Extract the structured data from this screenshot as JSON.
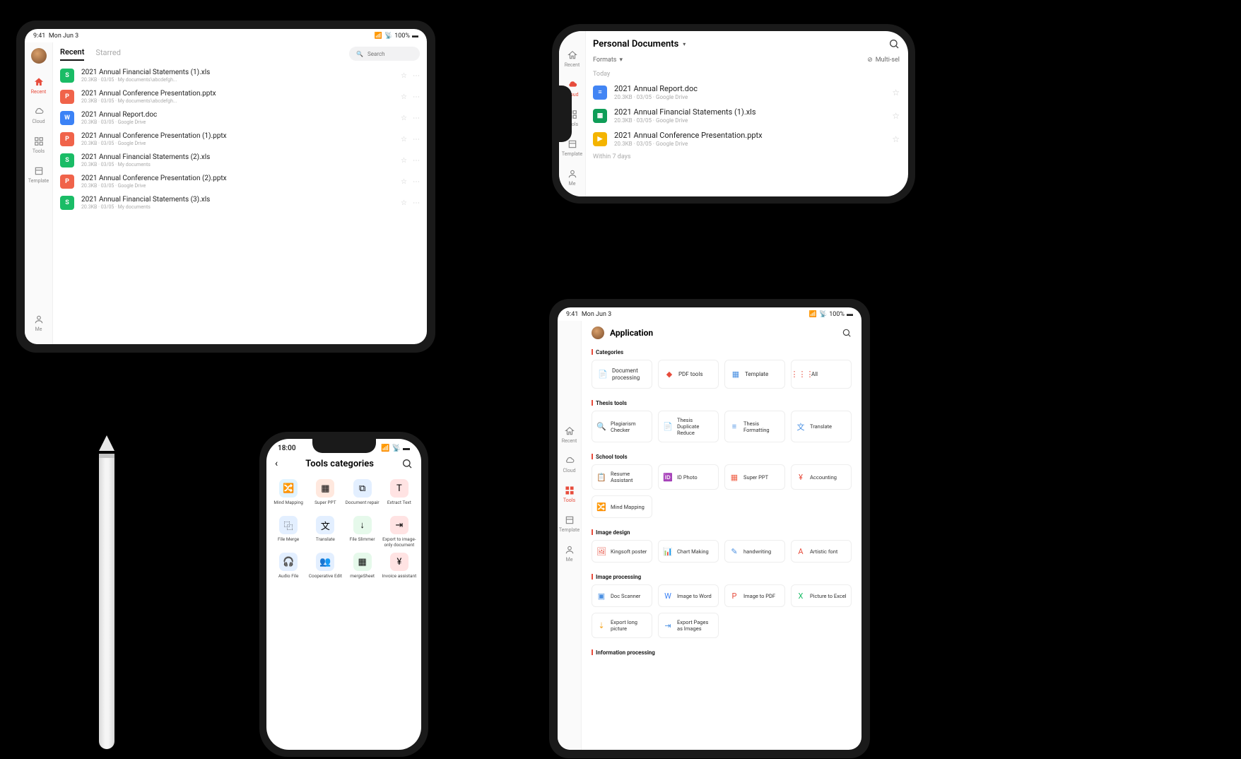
{
  "status": {
    "time": "9:41",
    "day": "Mon Jun 3",
    "battery": "100%"
  },
  "dev3_status_time": "18:00",
  "ipad1": {
    "nav": {
      "recent": "Recent",
      "cloud": "Cloud",
      "tools": "Tools",
      "template": "Template",
      "me": "Me"
    },
    "tabs": {
      "recent": "Recent",
      "starred": "Starred"
    },
    "search_placeholder": "Search",
    "files": [
      {
        "name": "2021 Annual Financial Statements (1).xls",
        "meta": "20.3KB · 03/05 · My documents\\abcdefgh...",
        "type": "xls"
      },
      {
        "name": "2021 Annual Conference Presentation.pptx",
        "meta": "20.3KB · 03/05 · My documents\\abcdefgh...",
        "type": "ppt"
      },
      {
        "name": "2021 Annual Report.doc",
        "meta": "20.3KB · 03/05 · Google Drive",
        "type": "doc"
      },
      {
        "name": "2021 Annual Conference Presentation (1).pptx",
        "meta": "20.3KB · 03/05 · Google Drive",
        "type": "ppt"
      },
      {
        "name": "2021 Annual Financial Statements (2).xls",
        "meta": "20.3KB · 03/05 · My documents",
        "type": "xls"
      },
      {
        "name": "2021 Annual Conference Presentation (2).pptx",
        "meta": "20.3KB · 03/05 · Google Drive",
        "type": "ppt"
      },
      {
        "name": "2021 Annual Financial Statements (3).xls",
        "meta": "20.3KB · 03/05 · My documents",
        "type": "xls"
      }
    ]
  },
  "phone_cloud": {
    "nav": {
      "recent": "Recent",
      "cloud": "Cloud",
      "tools": "Tools",
      "template": "Template",
      "me": "Me"
    },
    "title": "Personal Documents",
    "formats": "Formats",
    "multi": "Multi-sel",
    "today": "Today",
    "within7": "Within 7 days",
    "files": [
      {
        "name": "2021 Annual Report.doc",
        "meta": "20.3KB · 03/05 · Google Drive",
        "type": "gdoc"
      },
      {
        "name": "2021 Annual Financial Statements (1).xls",
        "meta": "20.3KB · 03/05 · Google Drive",
        "type": "gsheet"
      },
      {
        "name": "2021 Annual Conference Presentation.pptx",
        "meta": "20.3KB · 03/05 · Google Drive",
        "type": "gslide"
      }
    ]
  },
  "phone_tools": {
    "title": "Tools categories",
    "tools": [
      {
        "label": "Mind Mapping",
        "color": "#e0f3ff",
        "glyph": "🔀"
      },
      {
        "label": "Super PPT",
        "color": "#ffe8de",
        "glyph": "▦"
      },
      {
        "label": "Document repair",
        "color": "#e3efff",
        "glyph": "⧉"
      },
      {
        "label": "Extract Text",
        "color": "#ffe3e3",
        "glyph": "T"
      },
      {
        "label": "File Merge",
        "color": "#e3efff",
        "glyph": "⿻"
      },
      {
        "label": "Translate",
        "color": "#e3efff",
        "glyph": "文"
      },
      {
        "label": "File Slimmer",
        "color": "#e6f9eb",
        "glyph": "↓"
      },
      {
        "label": "Export to image-only document",
        "color": "#ffe3e3",
        "glyph": "⇥"
      },
      {
        "label": "Audio File",
        "color": "#e3efff",
        "glyph": "🎧"
      },
      {
        "label": "Cooperative Edit",
        "color": "#e3efff",
        "glyph": "👥"
      },
      {
        "label": "mergeSheet",
        "color": "#e6f9eb",
        "glyph": "▦"
      },
      {
        "label": "Invoice assistant",
        "color": "#ffe3e3",
        "glyph": "¥"
      }
    ]
  },
  "ipad_app": {
    "nav": {
      "recent": "Recent",
      "cloud": "Cloud",
      "tools": "Tools",
      "template": "Template",
      "me": "Me"
    },
    "title": "Application",
    "sections": {
      "categories": "Categories",
      "thesis": "Thesis tools",
      "school": "School tools",
      "image_design": "Image design",
      "image_proc": "Image processing",
      "info_proc": "Information processing"
    },
    "categories": [
      {
        "label": "Document processing",
        "glyph": "📄",
        "color": "#4a90e2"
      },
      {
        "label": "PDF tools",
        "glyph": "◆",
        "color": "#e74c3c"
      },
      {
        "label": "Template",
        "glyph": "▦",
        "color": "#4a90e2"
      },
      {
        "label": "All",
        "glyph": "⋮⋮⋮",
        "color": "#e74c3c"
      }
    ],
    "thesis": [
      {
        "label": "Plagiarism Checker",
        "glyph": "🔍",
        "color": "#4a90e2"
      },
      {
        "label": "Thesis Duplicate Reduce",
        "glyph": "📄",
        "color": "#e74c3c"
      },
      {
        "label": "Thesis Formatting",
        "glyph": "≡",
        "color": "#4a90e2"
      },
      {
        "label": "Translate",
        "glyph": "文",
        "color": "#4a90e2"
      }
    ],
    "school": [
      {
        "label": "Resume Assistant",
        "glyph": "📋",
        "color": "#f5a623"
      },
      {
        "label": "ID Photo",
        "glyph": "🆔",
        "color": "#e74c3c"
      },
      {
        "label": "Super PPT",
        "glyph": "▦",
        "color": "#f0634a"
      },
      {
        "label": "Accounting",
        "glyph": "¥",
        "color": "#e74c3c"
      },
      {
        "label": "Mind Mapping",
        "glyph": "🔀",
        "color": "#4a90e2"
      }
    ],
    "image_design": [
      {
        "label": "Kingsoft poster",
        "glyph": "🖼",
        "color": "#e74c3c"
      },
      {
        "label": "Chart Making",
        "glyph": "📊",
        "color": "#1abc66"
      },
      {
        "label": "handwriting",
        "glyph": "✎",
        "color": "#4a90e2"
      },
      {
        "label": "Artistic font",
        "glyph": "A",
        "color": "#e74c3c"
      }
    ],
    "image_proc": [
      {
        "label": "Doc Scanner",
        "glyph": "▣",
        "color": "#4a90e2"
      },
      {
        "label": "Image to Word",
        "glyph": "W",
        "color": "#3b82f6"
      },
      {
        "label": "Image to PDF",
        "glyph": "P",
        "color": "#e74c3c"
      },
      {
        "label": "Picture to Excel",
        "glyph": "X",
        "color": "#1abc66"
      },
      {
        "label": "Export long picture",
        "glyph": "⇣",
        "color": "#f5a623"
      },
      {
        "label": "Export Pages as Images",
        "glyph": "⇥",
        "color": "#4a90e2"
      }
    ]
  }
}
